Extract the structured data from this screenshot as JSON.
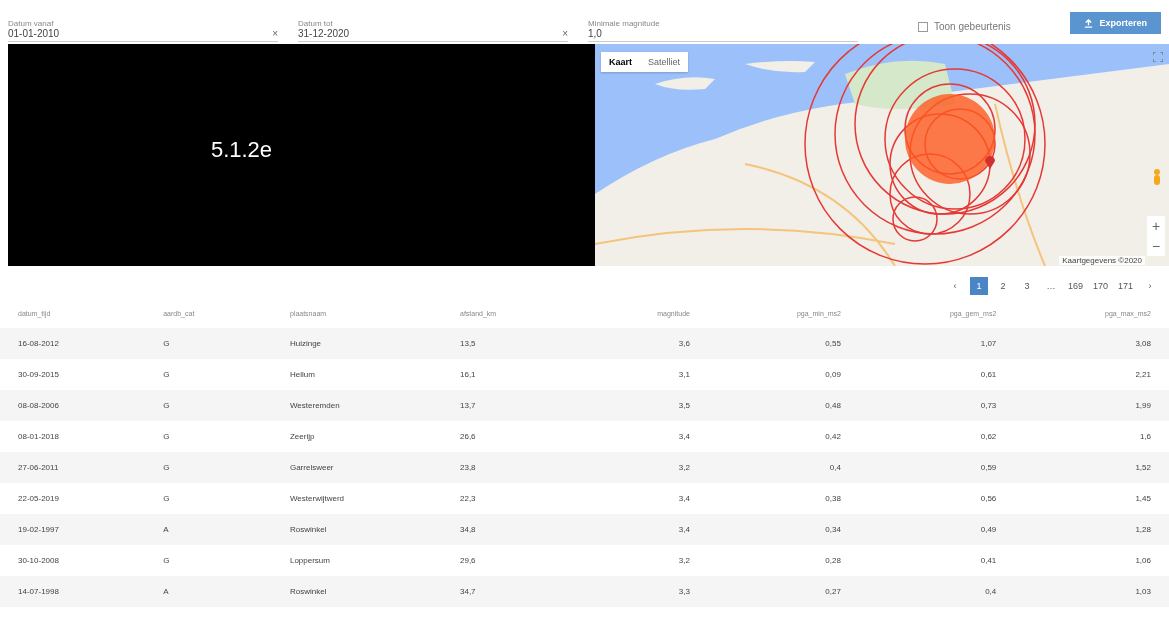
{
  "filters": [
    {
      "label": "Datum vanaf",
      "value": "01-01-2010",
      "clear": "×"
    },
    {
      "label": "Datum tot",
      "value": "31-12-2020",
      "clear": "×"
    },
    {
      "label": "Minimale magnitude",
      "value": "1,0"
    }
  ],
  "checkbox": {
    "label": "Toon gebeurtenis",
    "checked": false
  },
  "export_button": {
    "label": "Exporteren"
  },
  "overlay": {
    "text": "5.1.2e"
  },
  "map": {
    "tabs": [
      {
        "label": "Kaart",
        "selected": true
      },
      {
        "label": "Satelliet",
        "selected": false
      }
    ],
    "zoom_in": "+",
    "zoom_out": "−",
    "attribution": "Kaartgegevens ©2020"
  },
  "pagination": {
    "prev": "‹",
    "next": "›",
    "pages": [
      {
        "label": "1",
        "selected": true
      },
      {
        "label": "2",
        "selected": false
      },
      {
        "label": "3",
        "selected": false
      },
      {
        "label": "…",
        "selected": false
      },
      {
        "label": "169",
        "selected": false
      },
      {
        "label": "170",
        "selected": false
      },
      {
        "label": "171",
        "selected": false
      }
    ]
  },
  "table": {
    "columns": [
      "datum_tijd",
      "aardb_cat",
      "plaatsnaam",
      "afstand_km",
      "magnitude",
      "pga_min_ms2",
      "pga_gem_ms2",
      "pga_max_ms2"
    ],
    "rows": [
      [
        "16-08-2012",
        "G",
        "Huizinge",
        "13,5",
        "3,6",
        "0,55",
        "1,07",
        "3,08"
      ],
      [
        "30-09-2015",
        "G",
        "Hellum",
        "16,1",
        "3,1",
        "0,09",
        "0,61",
        "2,21"
      ],
      [
        "08-08-2006",
        "G",
        "Westeremden",
        "13,7",
        "3,5",
        "0,48",
        "0,73",
        "1,99"
      ],
      [
        "08-01-2018",
        "G",
        "Zeerijp",
        "26,6",
        "3,4",
        "0,42",
        "0,62",
        "1,6"
      ],
      [
        "27-06-2011",
        "G",
        "Garrelsweer",
        "23,8",
        "3,2",
        "0,4",
        "0,59",
        "1,52"
      ],
      [
        "22-05-2019",
        "G",
        "Westerwijtwerd",
        "22,3",
        "3,4",
        "0,38",
        "0,56",
        "1,45"
      ],
      [
        "19-02-1997",
        "A",
        "Roswinkel",
        "34,8",
        "3,4",
        "0,34",
        "0,49",
        "1,28"
      ],
      [
        "30-10-2008",
        "G",
        "Loppersum",
        "29,6",
        "3,2",
        "0,28",
        "0,41",
        "1,06"
      ],
      [
        "14-07-1998",
        "A",
        "Roswinkel",
        "34,7",
        "3,3",
        "0,27",
        "0,4",
        "1,03"
      ]
    ]
  }
}
